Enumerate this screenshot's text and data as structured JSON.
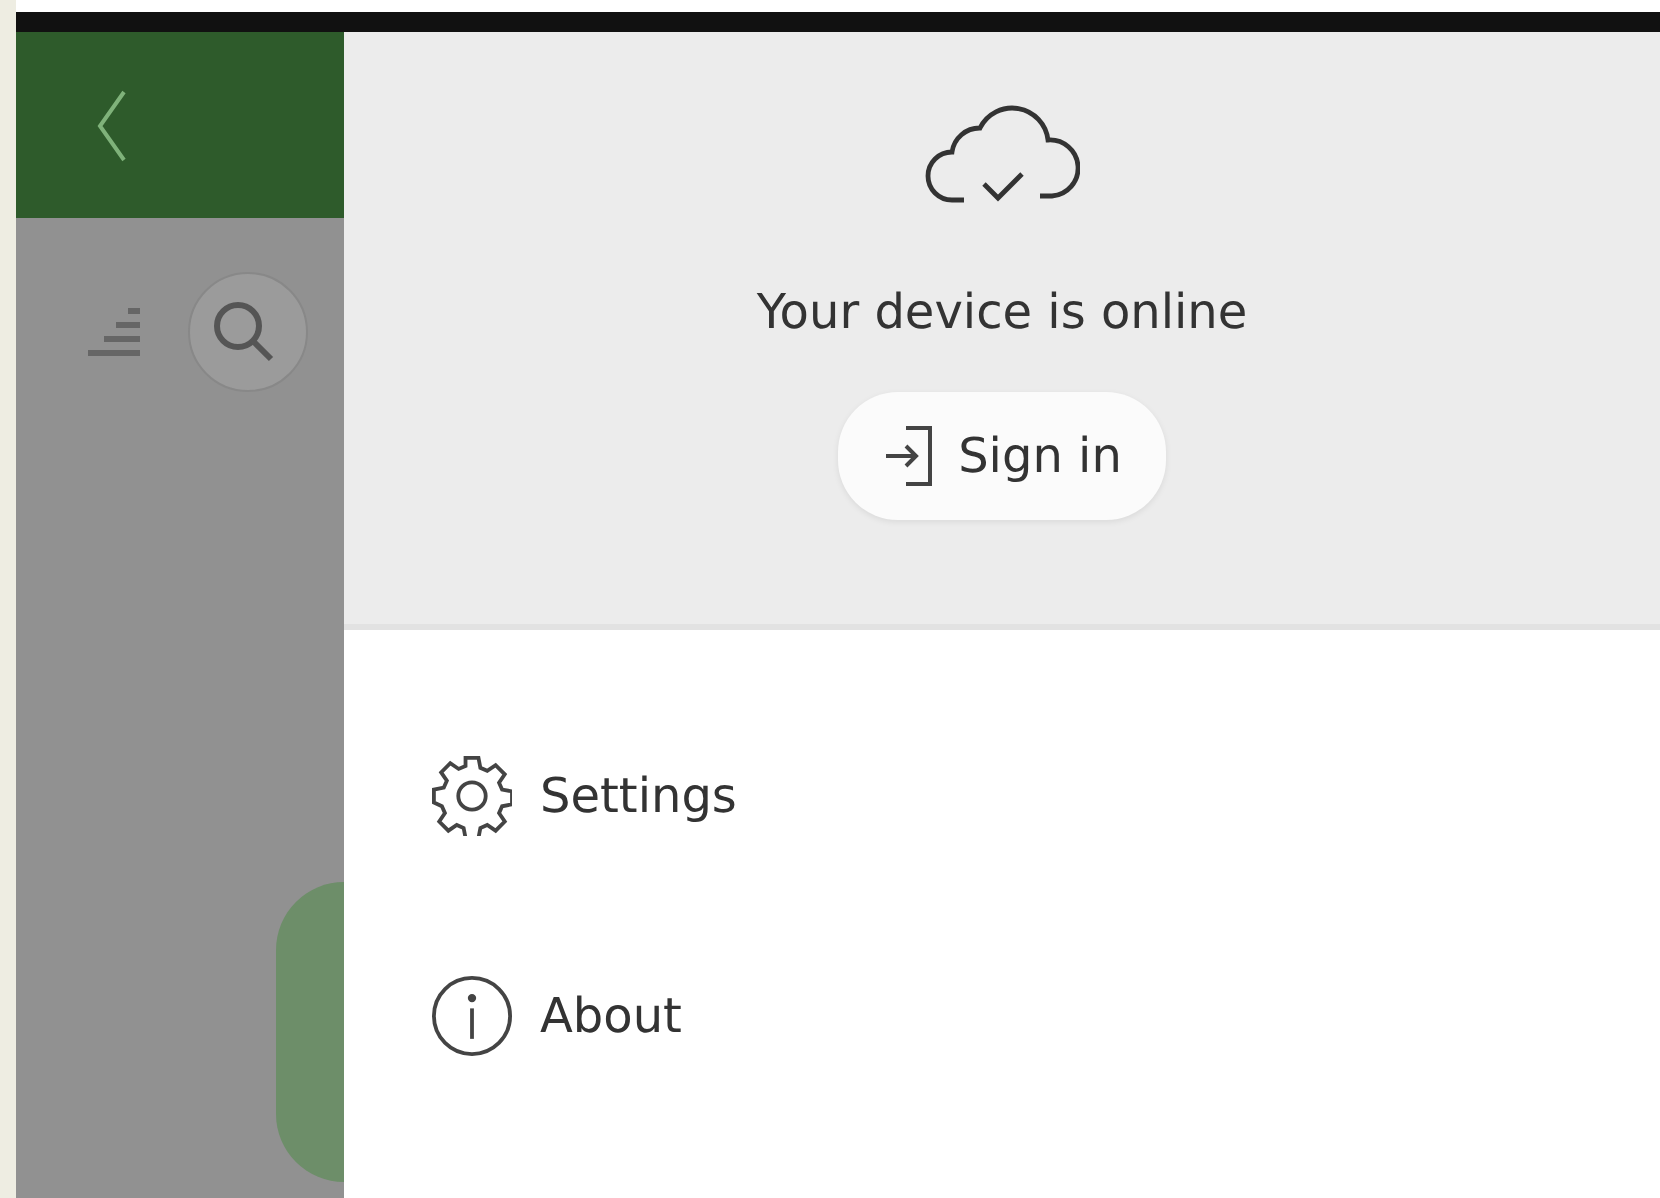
{
  "status": {
    "text": "Your device is online"
  },
  "sign_in": {
    "label": "Sign in"
  },
  "menu": [
    {
      "kind": "settings",
      "label": "Settings"
    },
    {
      "kind": "about",
      "label": "About"
    }
  ]
}
